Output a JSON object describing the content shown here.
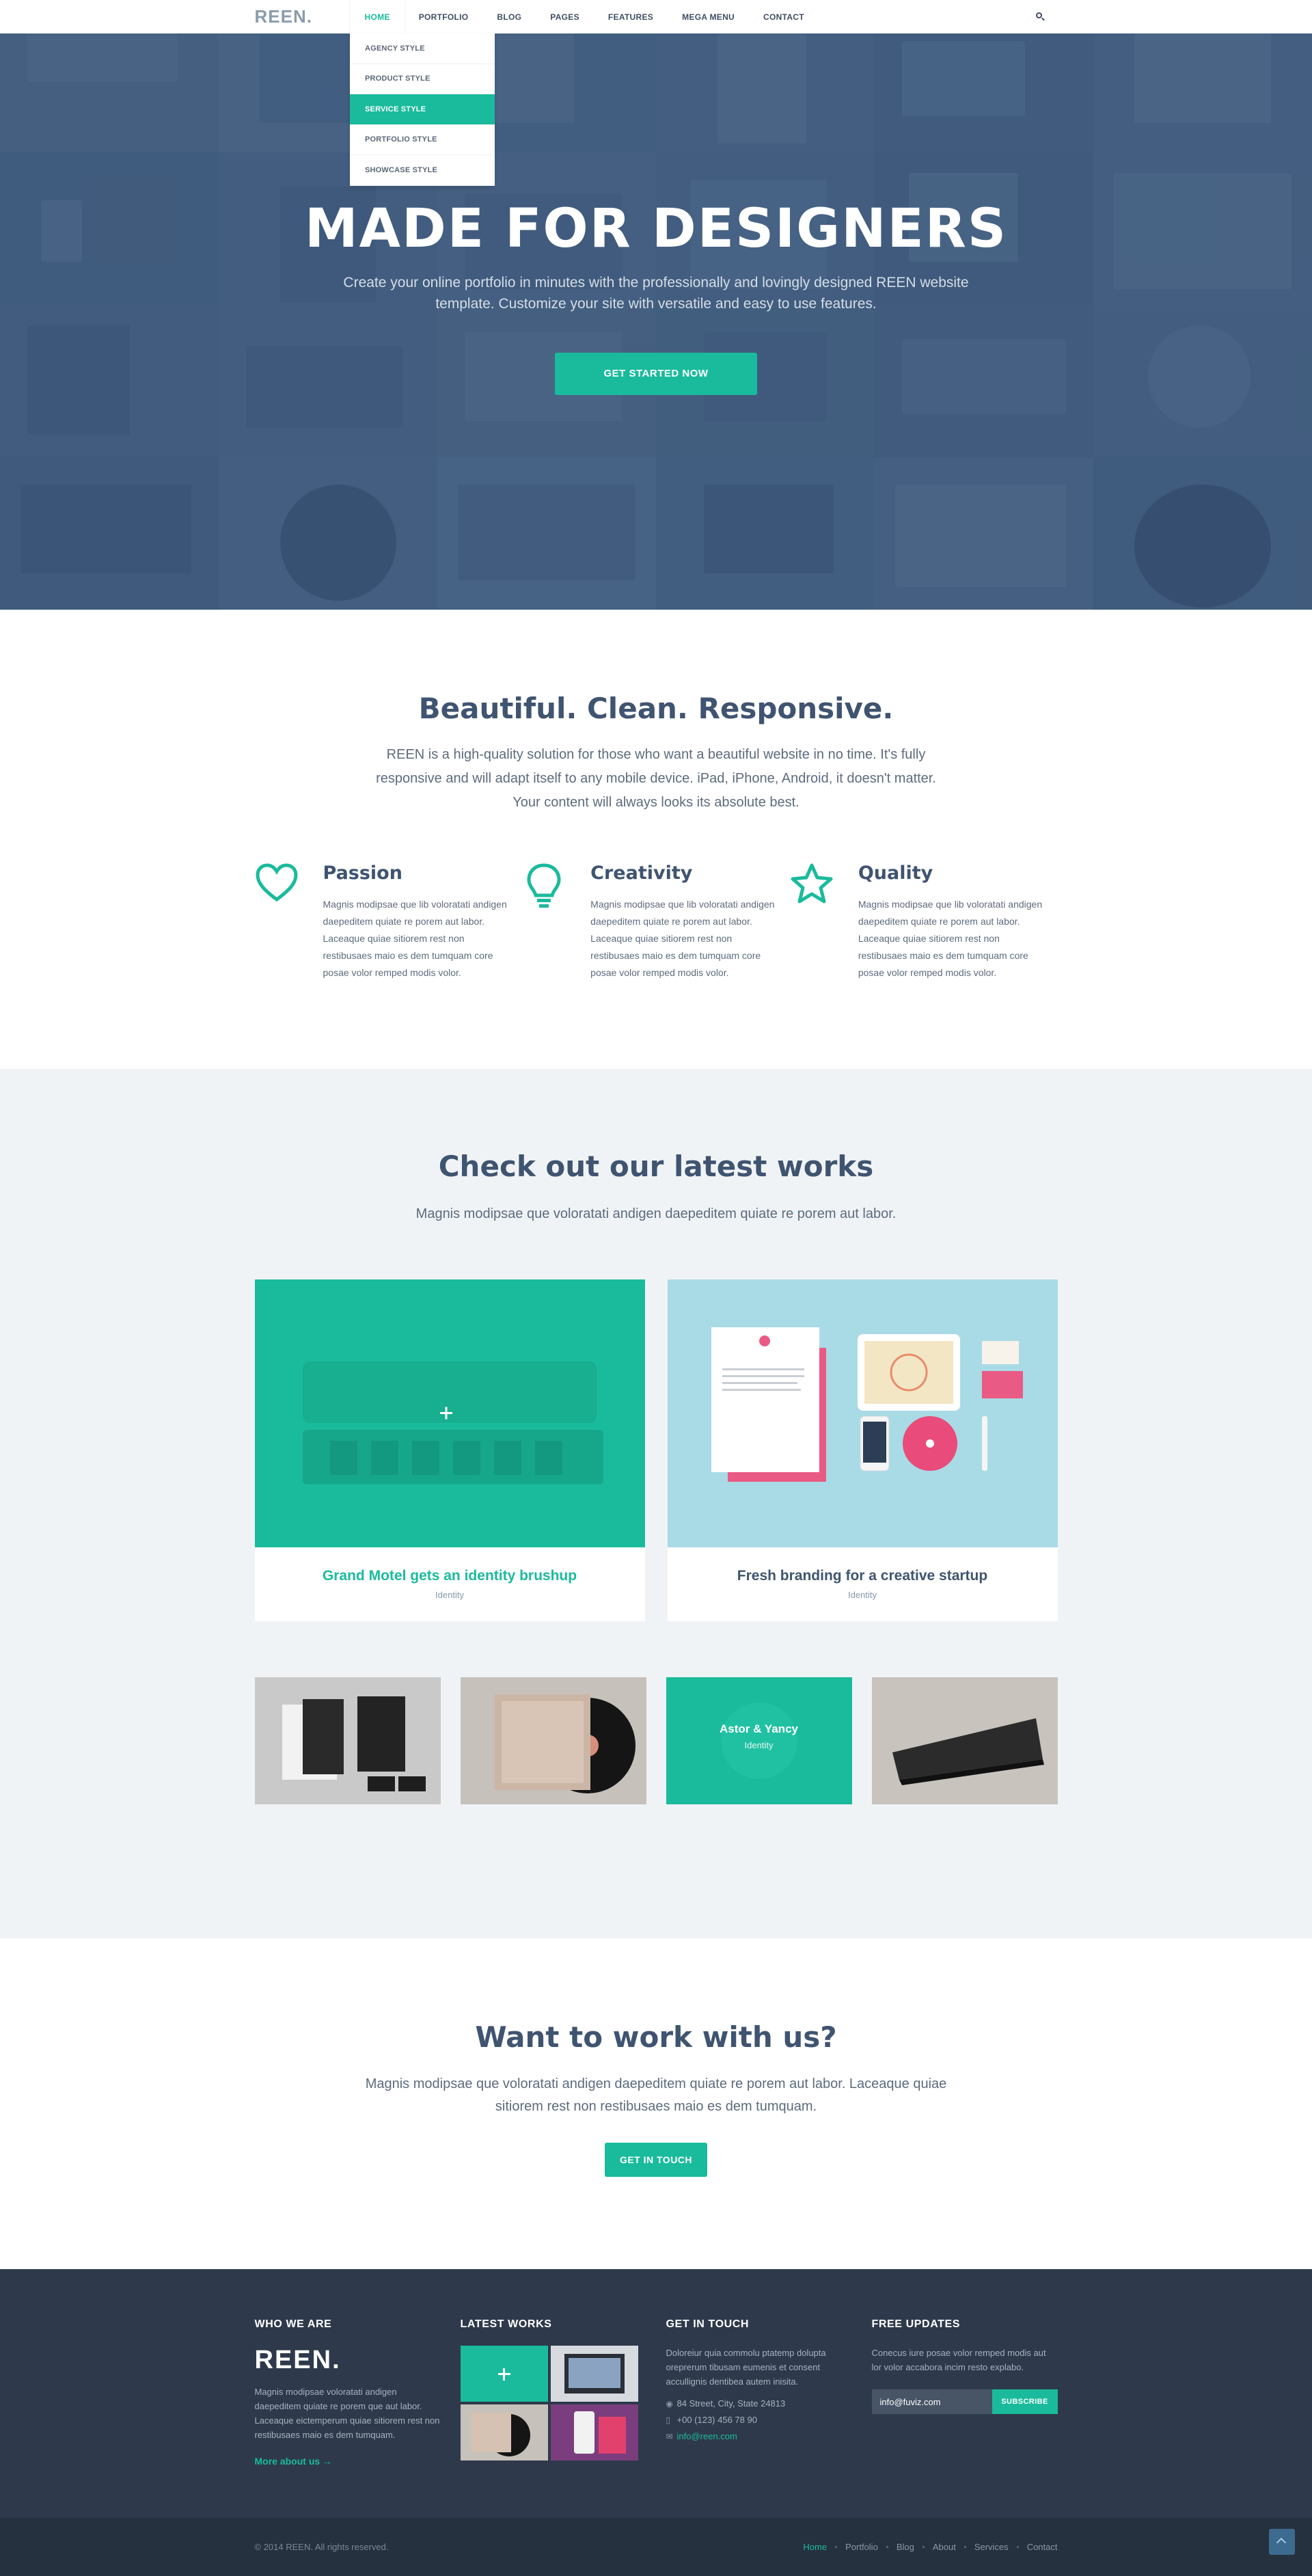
{
  "brand": {
    "logo": "REEN."
  },
  "nav": {
    "items": [
      "HOME",
      "PORTFOLIO",
      "BLOG",
      "PAGES",
      "FEATURES",
      "MEGA MENU",
      "CONTACT"
    ],
    "active": "HOME",
    "dropdown": [
      "AGENCY STYLE",
      "PRODUCT STYLE",
      "SERVICE STYLE",
      "PORTFOLIO STYLE",
      "SHOWCASE STYLE"
    ],
    "dropdown_highlight": "SERVICE STYLE",
    "search_icon": "search-icon"
  },
  "hero": {
    "title": "MADE FOR DESIGNERS",
    "subtitle": "Create your online portfolio in minutes with the professionally and lovingly designed REEN website template. Customize your site with versatile and easy to use features.",
    "button": "GET STARTED NOW"
  },
  "intro": {
    "title": "Beautiful. Clean. Responsive.",
    "lead": "REEN is a high-quality solution for those who want a beautiful website in no time. It's fully responsive and will adapt itself to any mobile device. iPad, iPhone, Android, it doesn't matter. Your content will always looks its absolute best.",
    "features": [
      {
        "icon": "heart-icon",
        "title": "Passion",
        "text": "Magnis modipsae que lib voloratati andigen daepeditem quiate re porem aut labor. Laceaque quiae sitiorem rest non restibusaes maio es dem tumquam core posae volor remped modis volor."
      },
      {
        "icon": "lightbulb-icon",
        "title": "Creativity",
        "text": "Magnis modipsae que lib voloratati andigen daepeditem quiate re porem aut labor. Laceaque quiae sitiorem rest non restibusaes maio es dem tumquam core posae volor remped modis volor."
      },
      {
        "icon": "star-icon",
        "title": "Quality",
        "text": "Magnis modipsae que lib voloratati andigen daepeditem quiate re porem aut labor. Laceaque quiae sitiorem rest non restibusaes maio es dem tumquam core posae volor remped modis volor."
      }
    ]
  },
  "works": {
    "title": "Check out our latest works",
    "lead": "Magnis modipsae que voloratati andigen daepeditem quiate re porem aut labor.",
    "big": [
      {
        "title": "Grand Motel gets an identity brushup",
        "category": "Identity"
      },
      {
        "title": "Fresh branding for a creative startup",
        "category": "Identity"
      }
    ],
    "small_overlay": {
      "title": "Astor & Yancy",
      "category": "Identity"
    }
  },
  "cta": {
    "title": "Want to work with us?",
    "lead": "Magnis modipsae que voloratati andigen daepeditem quiate re porem aut labor. Laceaque quiae sitiorem rest non restibusaes maio es dem tumquam.",
    "button": "GET IN TOUCH"
  },
  "footer": {
    "who": {
      "heading": "WHO WE ARE",
      "logo": "REEN.",
      "text": "Magnis modipsae voloratati andigen daepeditem quiate re porem que aut labor. Laceaque eictemperum quiae sitiorem rest non restibusaes maio es dem tumquam.",
      "link": "More about us →"
    },
    "latest": {
      "heading": "LATEST WORKS"
    },
    "contact": {
      "heading": "GET IN TOUCH",
      "text": "Doloreiur quia commolu ptatemp dolupta oreprerum tibusam eumenis et consent accullignis dentibea autem inisita.",
      "address": "84 Street, City, State 24813",
      "phone": "+00 (123) 456 78 90",
      "email": "info@reen.com"
    },
    "updates": {
      "heading": "FREE UPDATES",
      "text": "Conecus iure posae volor remped modis aut lor volor accabora incim resto explabo.",
      "input_value": "info@fuviz.com",
      "button": "SUBSCRIBE"
    }
  },
  "bottom": {
    "copyright": "© 2014 REEN. All rights reserved.",
    "links": [
      "Home",
      "Portfolio",
      "Blog",
      "About",
      "Services",
      "Contact"
    ],
    "active": "Home"
  },
  "colors": {
    "accent": "#1abb9c",
    "heading": "#3f5470",
    "footer_bg": "#2e3a4b",
    "hero_overlay": "#3a5678"
  }
}
